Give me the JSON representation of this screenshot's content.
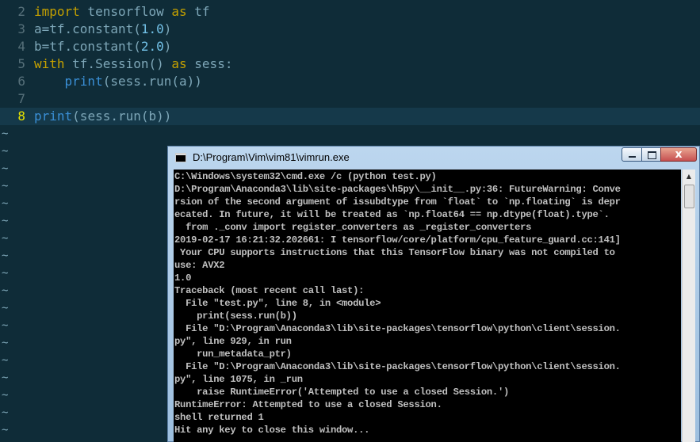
{
  "editor": {
    "lines": [
      {
        "num": "2",
        "tokens": [
          {
            "t": "import",
            "c": "kw"
          },
          {
            "t": " tensorflow ",
            "c": "pl"
          },
          {
            "t": "as",
            "c": "kw"
          },
          {
            "t": " tf",
            "c": "pl"
          }
        ]
      },
      {
        "num": "3",
        "tokens": [
          {
            "t": "a=tf.constant(",
            "c": "pl"
          },
          {
            "t": "1.0",
            "c": "nm"
          },
          {
            "t": ")",
            "c": "pl"
          }
        ]
      },
      {
        "num": "4",
        "tokens": [
          {
            "t": "b=tf.constant(",
            "c": "pl"
          },
          {
            "t": "2.0",
            "c": "nm"
          },
          {
            "t": ")",
            "c": "pl"
          }
        ]
      },
      {
        "num": "5",
        "tokens": [
          {
            "t": "with",
            "c": "kw"
          },
          {
            "t": " tf.Session() ",
            "c": "pl"
          },
          {
            "t": "as",
            "c": "kw"
          },
          {
            "t": " sess:",
            "c": "pl"
          }
        ]
      },
      {
        "num": "6",
        "tokens": [
          {
            "t": "    ",
            "c": "pl"
          },
          {
            "t": "print",
            "c": "fn"
          },
          {
            "t": "(sess.run(a))",
            "c": "pl"
          }
        ]
      },
      {
        "num": "7",
        "tokens": []
      },
      {
        "num": "8",
        "tokens": [
          {
            "t": "print",
            "c": "fn"
          },
          {
            "t": "(sess.run(b))",
            "c": "pl"
          }
        ],
        "current": true
      }
    ],
    "tilde": "~"
  },
  "cmd_window": {
    "title": "D:\\Program\\Vim\\vim81\\vimrun.exe",
    "close_label": "x",
    "output": [
      "C:\\Windows\\system32\\cmd.exe /c (python test.py)",
      "D:\\Program\\Anaconda3\\lib\\site-packages\\h5py\\__init__.py:36: FutureWarning: Conve",
      "rsion of the second argument of issubdtype from `float` to `np.floating` is depr",
      "ecated. In future, it will be treated as `np.float64 == np.dtype(float).type`.",
      "  from ._conv import register_converters as _register_converters",
      "2019-02-17 16:21:32.202661: I tensorflow/core/platform/cpu_feature_guard.cc:141]",
      " Your CPU supports instructions that this TensorFlow binary was not compiled to",
      "use: AVX2",
      "1.0",
      "Traceback (most recent call last):",
      "  File \"test.py\", line 8, in <module>",
      "    print(sess.run(b))",
      "  File \"D:\\Program\\Anaconda3\\lib\\site-packages\\tensorflow\\python\\client\\session.",
      "py\", line 929, in run",
      "    run_metadata_ptr)",
      "  File \"D:\\Program\\Anaconda3\\lib\\site-packages\\tensorflow\\python\\client\\session.",
      "py\", line 1075, in _run",
      "    raise RuntimeError('Attempted to use a closed Session.')",
      "RuntimeError: Attempted to use a closed Session.",
      "shell returned 1",
      "Hit any key to close this window..."
    ]
  },
  "colors": {
    "editor_bg": "#0f2c38",
    "keyword": "#c4a000",
    "function": "#3a8fd6",
    "number": "#73c2e8",
    "plain": "#7ea7b8",
    "current_line_number": "#e6e200"
  },
  "icons": {
    "app_icon": "console-icon",
    "minimize": "minimize-icon",
    "maximize": "maximize-icon",
    "close": "close-icon",
    "scroll_up": "scroll-up-arrow-icon"
  }
}
